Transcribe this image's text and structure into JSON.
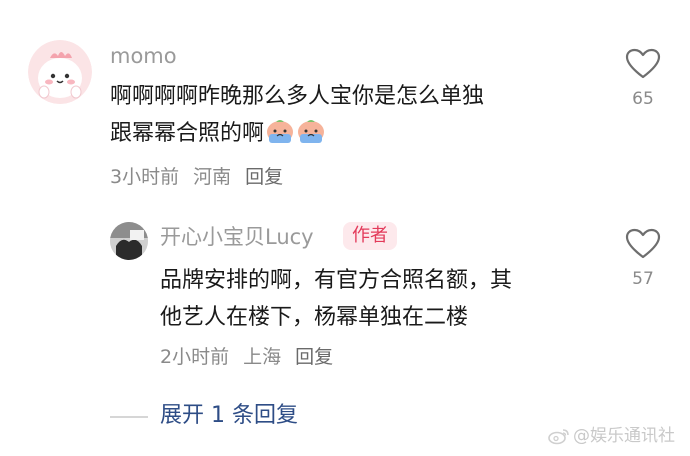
{
  "comments": [
    {
      "username": "momo",
      "text_line1": "啊啊啊啊昨晚那么多人宝你是怎么单独",
      "text_line2": "跟幂幂合照的啊",
      "time": "3小时前",
      "location": "河南",
      "reply_label": "回复",
      "likes": "65",
      "emoji": "crying-peach-emoji"
    },
    {
      "username": "开心小宝贝Lucy",
      "badge": "作者",
      "text_line1": "品牌安排的啊，有官方合照名额，其",
      "text_line2": "他艺人在楼下，杨幂单独在二楼",
      "time": "2小时前",
      "location": "上海",
      "reply_label": "回复",
      "likes": "57"
    }
  ],
  "expand_replies": "展开 1 条回复",
  "watermark": "@娱乐通讯社",
  "icons": {
    "like": "heart-outline-icon",
    "watermark": "weibo-logo-icon"
  },
  "colors": {
    "text": "#1a1a1a",
    "meta": "#8a8a8a",
    "link": "#2e4d86",
    "badge_bg": "#fde9ec",
    "badge_text": "#e33a5a"
  }
}
